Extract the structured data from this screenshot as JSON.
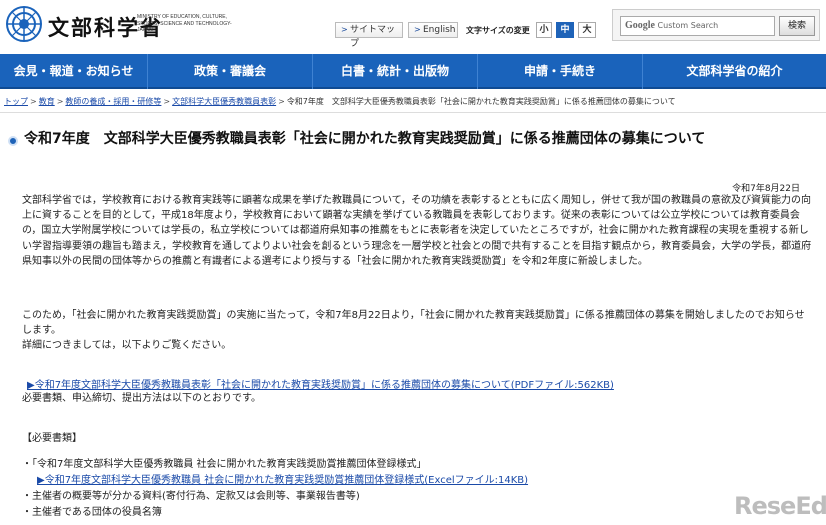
{
  "header": {
    "logo_name": "文部科学省",
    "logo_en": "MINISTRY OF EDUCATION, CULTURE, SPORTS, SCIENCE AND TECHNOLOGY-JAPAN",
    "sitemap_label": "サイトマップ",
    "english_label": "English",
    "fontsize_label": "文字サイズの変更",
    "fontsize_small": "小",
    "fontsize_medium": "中",
    "fontsize_large": "大",
    "search_brand": "Google",
    "search_placeholder": "Custom Search",
    "search_button": "検索",
    "accent_color": "#1a63bb"
  },
  "nav": {
    "items": [
      "会見・報道・お知らせ",
      "政策・審議会",
      "白書・統計・出版物",
      "申請・手続き",
      "文部科学省の紹介"
    ]
  },
  "breadcrumb": {
    "items": [
      "トップ",
      "教育",
      "教師の養成・採用・研修等",
      "文部科学大臣優秀教職員表彰"
    ],
    "current": "令和7年度　文部科学大臣優秀教職員表彰「社会に開かれた教育実践奨励賞」に係る推薦団体の募集について"
  },
  "main": {
    "title": "令和7年度　文部科学大臣優秀教職員表彰「社会に開かれた教育実践奨励賞」に係る推薦団体の募集について",
    "date": "令和7年8月22日",
    "para1": "文部科学省では，学校教育における教育実践等に顕著な成果を挙げた教職員について，その功績を表彰するとともに広く周知し，併せて我が国の教職員の意欲及び資質能力の向上に資することを目的として，平成18年度より，学校教育において顕著な実績を挙げている教職員を表彰しております。従来の表彰については公立学校については教育委員会の，国立大学附属学校については学長の，私立学校については都道府県知事の推薦をもとに表彰者を決定していたところですが，社会に開かれた教育課程の実現を重視する新しい学習指導要領の趣旨も踏まえ，学校教育を通してよりよい社会を創るという理念を一層学校と社会との間で共有することを目指す観点から，教育委員会，大学の学長，都道府県知事以外の民間の団体等からの推薦と有識者による選考により授与する「社会に開かれた教育実践奨励賞」を令和2年度に新設しました。",
    "para2": "このため，「社会に開かれた教育実践奨励賞」の実施に当たって，令和7年8月22日より，「社会に開かれた教育実践奨励賞」に係る推薦団体の募集を開始しましたのでお知らせします。\n詳細につきましては，以下よりご覧ください。",
    "link1": "▶令和7年度文部科学大臣優秀教職員表彰「社会に開かれた教育実践奨励賞」に係る推薦団体の募集について(PDFファイル:562KB)",
    "para3": "必要書類、申込締切、提出方法は以下のとおりです。",
    "section_head": "【必要書類】",
    "list": {
      "item1": "・「令和7年度文部科学大臣優秀教職員 社会に開かれた教育実践奨励賞推薦団体登録様式」",
      "item1_link": "▶令和7年度文部科学大臣優秀教職員 社会に開かれた教育実践奨励賞推薦団体登録様式(Excelファイル:14KB)",
      "item2": "・主催者の概要等が分かる資料(寄付行為、定款又は会則等、事業報告書等)",
      "item3": "・主催者である団体の役員名簿"
    }
  },
  "watermark": {
    "text": "ReseEd",
    "color": "#bdbdbd"
  }
}
